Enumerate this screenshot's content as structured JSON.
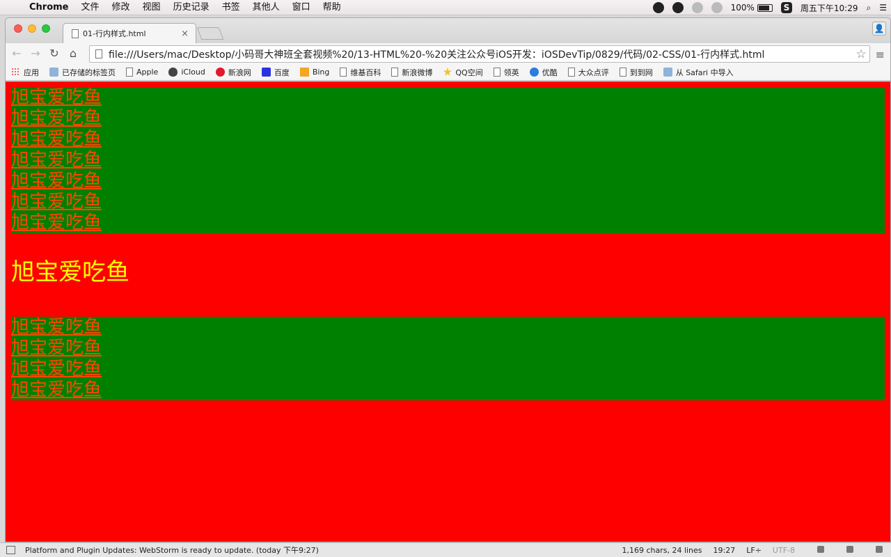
{
  "menubar": {
    "apple_glyph": "",
    "app_name": "Chrome",
    "items": [
      "文件",
      "修改",
      "视图",
      "历史记录",
      "书签",
      "其他人",
      "窗口",
      "帮助"
    ],
    "battery": "100%",
    "clock": "周五下午10:29",
    "search_glyph": "⌕",
    "list_glyph": "☰"
  },
  "browser": {
    "tab_title": "01-行内样式.html",
    "tab_close": "×",
    "profile_glyph": "👤",
    "back_glyph": "←",
    "forward_glyph": "→",
    "reload_glyph": "↻",
    "home_glyph": "⌂",
    "url": "file:///Users/mac/Desktop/小码哥大神班全套视频%20/13-HTML%20-%20关注公众号iOS开发：iOSDevTip/0829/代码/02-CSS/01-行内样式.html",
    "star_glyph": "☆",
    "menu_glyph": "≡",
    "bookmarks": [
      {
        "label": "应用",
        "icon": "grid"
      },
      {
        "label": "已存储的标签页",
        "icon": "folder"
      },
      {
        "label": "Apple",
        "icon": "page"
      },
      {
        "label": "iCloud",
        "icon": "apple"
      },
      {
        "label": "新浪网",
        "icon": "weibo"
      },
      {
        "label": "百度",
        "icon": "baidu"
      },
      {
        "label": "Bing",
        "icon": "bing"
      },
      {
        "label": "维基百科",
        "icon": "page"
      },
      {
        "label": "新浪微博",
        "icon": "page"
      },
      {
        "label": "QQ空间",
        "icon": "qq"
      },
      {
        "label": "领英",
        "icon": "page"
      },
      {
        "label": "优酷",
        "icon": "youku"
      },
      {
        "label": "大众点评",
        "icon": "page"
      },
      {
        "label": "到到网",
        "icon": "page"
      },
      {
        "label": "从 Safari 中导入",
        "icon": "folder"
      }
    ]
  },
  "page": {
    "block1_lines": [
      "旭宝爱吃鱼",
      "旭宝爱吃鱼",
      "旭宝爱吃鱼",
      "旭宝爱吃鱼",
      "旭宝爱吃鱼",
      "旭宝爱吃鱼",
      "旭宝爱吃鱼"
    ],
    "heading_text": "旭宝爱吃鱼",
    "block2_lines": [
      "旭宝爱吃鱼",
      "旭宝爱吃鱼",
      "旭宝爱吃鱼",
      "旭宝爱吃鱼"
    ],
    "colors": {
      "page_background": "#ff0000",
      "block_background": "#008000",
      "block_text": "#ff4500",
      "heading_text": "#ffff00"
    }
  },
  "ide_status": {
    "message": "Platform and Plugin Updates: WebStorm is ready to update. (today 下午9:27)",
    "chars": "1,169 chars, 24 lines",
    "position": "19:27",
    "line_sep": "LF÷",
    "encoding": "UTF-8"
  }
}
